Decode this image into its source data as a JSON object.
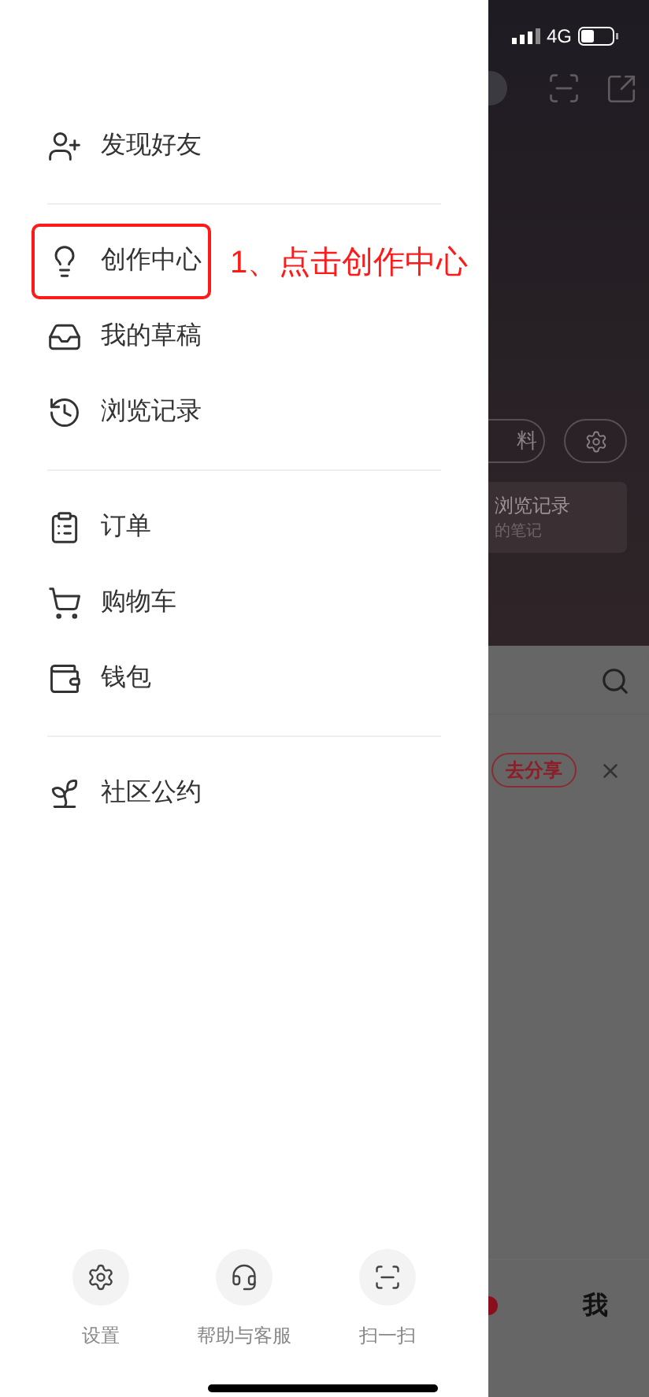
{
  "status_bar": {
    "network": "4G"
  },
  "menu_groups": [
    [
      {
        "label": "发现好友",
        "highlighted": false
      }
    ],
    [
      {
        "label": "创作中心",
        "highlighted": true
      },
      {
        "label": "我的草稿",
        "highlighted": false
      },
      {
        "label": "浏览记录",
        "highlighted": false
      }
    ],
    [
      {
        "label": "订单",
        "highlighted": false
      },
      {
        "label": "购物车",
        "highlighted": false
      },
      {
        "label": "钱包",
        "highlighted": false
      }
    ],
    [
      {
        "label": "社区公约",
        "highlighted": false
      }
    ]
  ],
  "annotation": {
    "text": "1、点击创作中心"
  },
  "bottom_actions": [
    {
      "label": "设置"
    },
    {
      "label": "帮助与客服"
    },
    {
      "label": "扫一扫"
    }
  ],
  "background": {
    "edit_button": "料",
    "history_title": "浏览记录",
    "history_subtitle": "的笔记",
    "share_button": "去分享",
    "tab_label": "我"
  }
}
